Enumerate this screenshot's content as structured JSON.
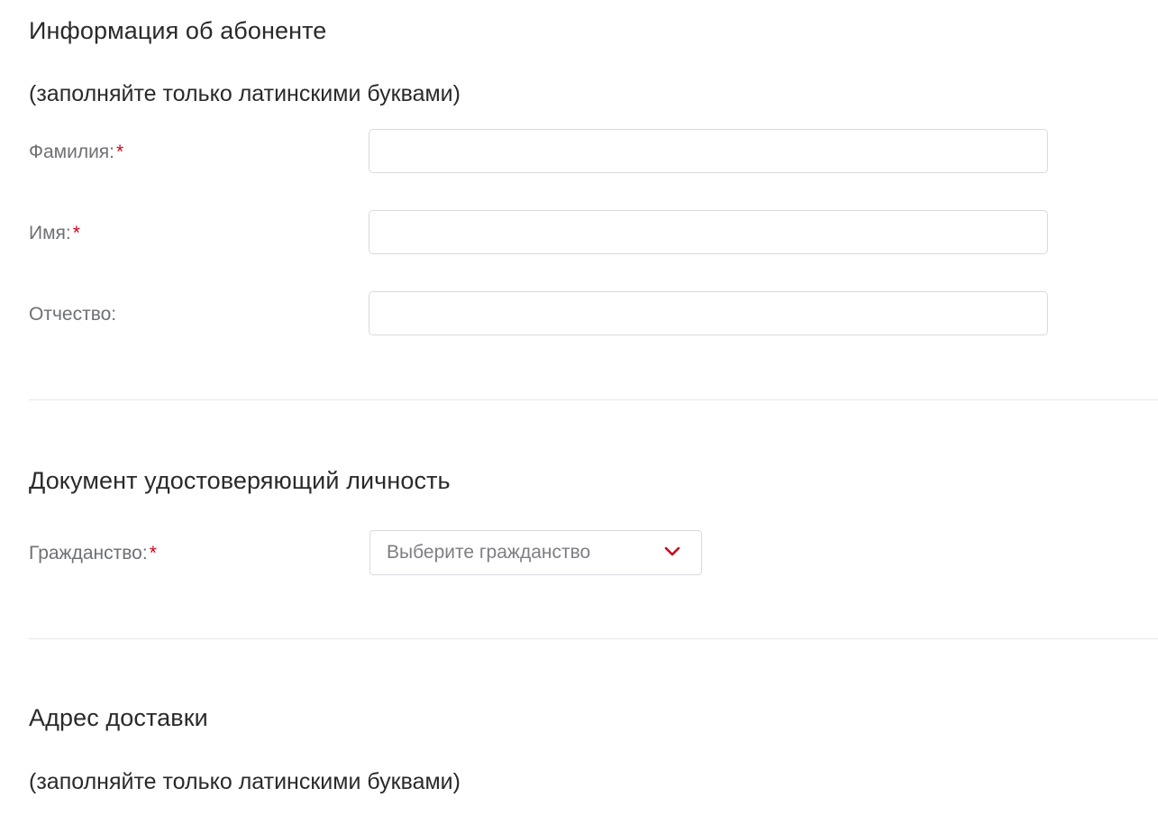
{
  "subscriber": {
    "title": "Информация об абоненте",
    "note": "(заполняйте только латинскими буквами)",
    "fields": {
      "last_name": {
        "label": "Фамилия:",
        "required_mark": "*",
        "value": ""
      },
      "first_name": {
        "label": "Имя:",
        "required_mark": "*",
        "value": ""
      },
      "middle_name": {
        "label": "Отчество:",
        "value": ""
      }
    }
  },
  "identity": {
    "title": "Документ удостоверяющий личность",
    "citizenship": {
      "label": "Гражданство:",
      "required_mark": "*",
      "placeholder": "Выберите гражданство"
    }
  },
  "delivery": {
    "title": "Адрес доставки",
    "note": "(заполняйте только латинскими буквами)"
  },
  "colors": {
    "accent": "#d0021b",
    "label": "#6e7075",
    "border": "#d8dadd"
  },
  "icons": {
    "select_chevron": "chevron-down-icon"
  }
}
